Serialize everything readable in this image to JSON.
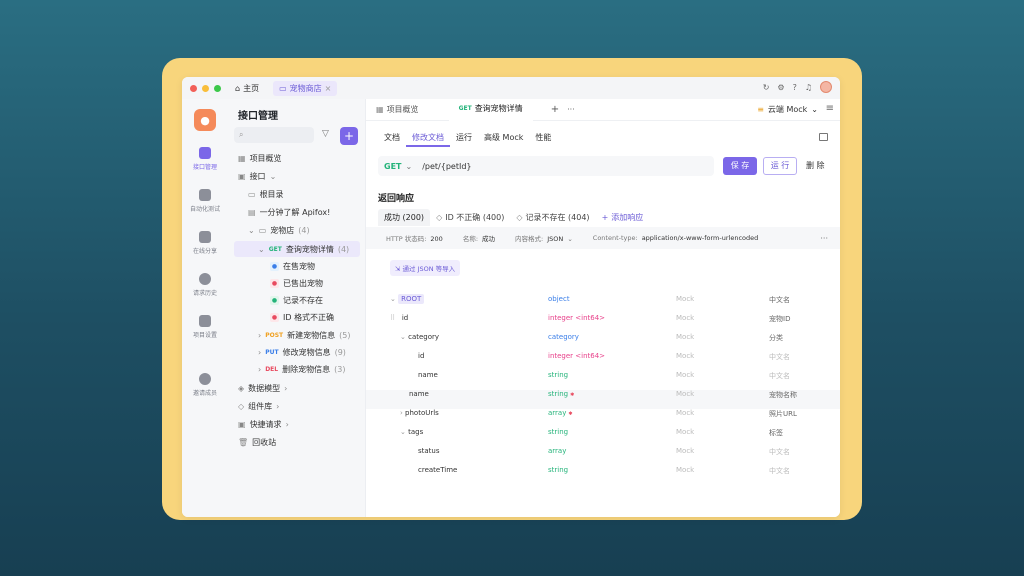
{
  "titlebar": {
    "home_label": "主页",
    "project_tab": "宠物商店",
    "close": "×",
    "mock_label": "云端 Mock"
  },
  "rail": [
    {
      "label": "接口管理",
      "icon": "api-icon",
      "active": true
    },
    {
      "label": "自动化测试",
      "icon": "test-icon",
      "active": false
    },
    {
      "label": "在线分享",
      "icon": "share-icon",
      "active": false
    },
    {
      "label": "请求历史",
      "icon": "history-icon",
      "active": false
    },
    {
      "label": "项目设置",
      "icon": "settings-icon",
      "active": false
    },
    {
      "label": "邀请成员",
      "icon": "invite-icon",
      "active": false
    }
  ],
  "tree": {
    "title": "接口管理",
    "items": {
      "overview": "项目概览",
      "interface": "接口",
      "root_dir": "根目录",
      "intro": "一分钟了解 Apifox!",
      "petshop": "宠物店",
      "petshop_count": "(4)",
      "get_label": "GET",
      "get_name": "查询宠物详情",
      "get_count": "(4)",
      "case1": "在售宠物",
      "case2": "已售出宠物",
      "case3": "记录不存在",
      "case4": "ID 格式不正确",
      "post_label": "POST",
      "post_name": "新建宠物信息",
      "post_count": "(5)",
      "put_label": "PUT",
      "put_name": "修改宠物信息",
      "put_count": "(9)",
      "del_label": "DEL",
      "del_name": "删除宠物信息",
      "del_count": "(3)",
      "models": "数据模型",
      "components": "组件库",
      "quick": "快捷请求",
      "trash": "回收站"
    }
  },
  "main": {
    "tab_overview": "项目概览",
    "tab_get_method": "GET",
    "tab_get_name": "查询宠物详情",
    "plus": "+",
    "dots": "···",
    "subtabs": [
      "文档",
      "修改文档",
      "运行",
      "高级 Mock",
      "性能"
    ],
    "method": "GET",
    "path": "/pet/{petId}",
    "save": "保 存",
    "run": "运 行",
    "delete": "删 除",
    "section_title": "返回响应",
    "resp_tabs": {
      "success": "成功 (200)",
      "bad_id": "ID 不正确 (400)",
      "not_found": "记录不存在 (404)",
      "add": "添加响应"
    },
    "meta": {
      "status_label": "HTTP 状态码:",
      "status_value": "200",
      "name_label": "名称:",
      "name_value": "成功",
      "format_label": "内容格式:",
      "format_value": "JSON",
      "ctype_label": "Content-type:",
      "ctype_value": "application/x-www-form-urlencoded"
    },
    "import_label": "通过 JSON 等导入"
  },
  "schema": [
    {
      "name": "ROOT",
      "type": "object",
      "mock": "Mock",
      "desc": "中文名"
    },
    {
      "name": "id",
      "type": "integer <int64>",
      "mock": "Mock",
      "desc": "宠物ID"
    },
    {
      "name": "category",
      "type": "category",
      "mock": "Mock",
      "desc": "分类"
    },
    {
      "name": "id",
      "type": "integer <int64>",
      "mock": "Mock",
      "desc": "中文名"
    },
    {
      "name": "name",
      "type": "string",
      "mock": "Mock",
      "desc": "中文名"
    },
    {
      "name": "name",
      "type": "string",
      "mock": "Mock",
      "desc": "宠物名称"
    },
    {
      "name": "photoUrls",
      "type": "array",
      "mock": "Mock",
      "desc": "照片URL"
    },
    {
      "name": "tags",
      "type": "string",
      "mock": "Mock",
      "desc": "标签"
    },
    {
      "name": "status",
      "type": "array",
      "mock": "Mock",
      "desc": "中文名"
    },
    {
      "name": "createTime",
      "type": "string",
      "mock": "Mock",
      "desc": "中文名"
    }
  ]
}
